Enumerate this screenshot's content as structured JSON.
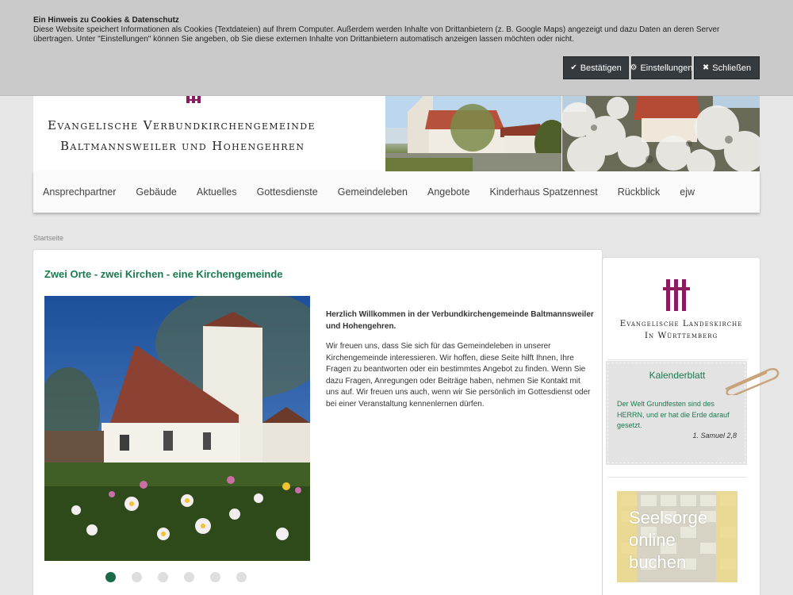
{
  "cookie": {
    "title": "Ein Hinweis zu Cookies & Datenschutz",
    "text": "Diese Website speichert Informationen als Cookies (Textdateien) auf Ihrem Computer. Außerdem werden Inhalte von Drittanbietern (z. B. Google Maps) angezeigt und dazu Daten an deren Server übertragen. Unter \"Einstellungen\" können Sie angeben, ob Sie diese externen Inhalte von Drittanbietern automatisch anzeigen lassen möchten oder nicht.",
    "buttons": {
      "confirm": "Bestätigen",
      "settings": "Einstellungen",
      "close": "Schließen"
    },
    "button_color": "#353a3e"
  },
  "header": {
    "line1": "Evangelische Verbundkirchengemeinde",
    "line2": "Baltmannsweiler und Hohengehren"
  },
  "nav": {
    "items": [
      "Ansprechpartner",
      "Gebäude",
      "Aktuelles",
      "Gottesdienste",
      "Gemeindeleben",
      "Angebote",
      "Kinderhaus Spatzennest",
      "Rückblick",
      "ejw"
    ]
  },
  "breadcrumb": "Startseite",
  "main": {
    "heading": "Zwei Orte - zwei Kirchen - eine Kirchengemeinde",
    "welcome": "Herzlich Willkommen in der Verbundkirchengemeinde Baltmannsweiler und Hohengehren.",
    "body": "Wir freuen uns, dass Sie sich für das Gemeindeleben in unserer Kirchengemeinde interessieren. Wir hoffen, diese Seite hilft Ihnen, Ihre Fragen zu beantworten oder ein bestimmtes Angebot zu finden. Wenn Sie dazu Fragen, Anregungen oder Beiträge haben, nehmen Sie Kontakt mit uns auf. Wir freuen uns auch, wenn wir Sie persönlich im Gottesdienst oder bei einer Veranstaltung kennenlernen dürfen.",
    "slider": {
      "slide_count": 6,
      "active_slide": 1
    },
    "accent": "#1a7a4e"
  },
  "sidebar": {
    "elk_line1": "Evangelische Landeskirche",
    "elk_line2": "In Württemberg",
    "kalender": {
      "title": "Kalenderblatt",
      "verse": "Der Welt Grundfesten sind des HERRN, und er hat die Erde darauf gesetzt.",
      "reference": "1. Samuel 2,8"
    },
    "seelsorge": [
      "Seelsorge",
      "online",
      "buchen"
    ]
  },
  "brand_purple": "#8b1c5f"
}
